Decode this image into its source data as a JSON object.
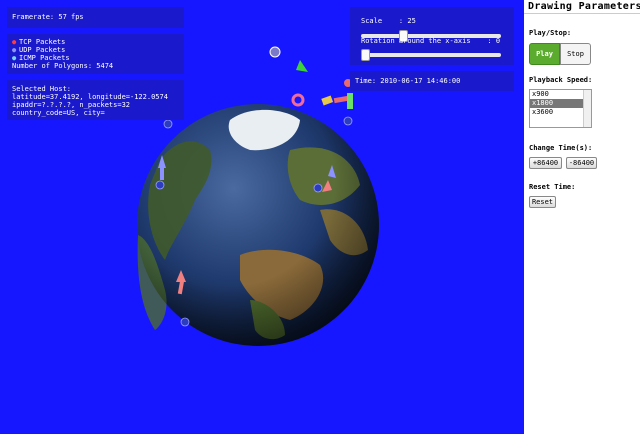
{
  "viewport": {
    "framerate": "Framerate: 57 fps",
    "legend": [
      "TCP Packets",
      "UDP Packets",
      "ICMP Packets"
    ],
    "polygons": "Number of Polygons: 5474",
    "host": [
      "Selected Host:",
      "latitude=37.4192, longitude=-122.0574",
      "ipaddr=?.?.?.?, n_packets=32",
      "country_code=US, city="
    ],
    "time": "Time: 2010-06-17 14:46:00",
    "scale_label": "Scale    : 25",
    "rotation_label": "Rotation around the x-axis    : 0",
    "scale_value": 25,
    "rotation_value": 0
  },
  "sidebar": {
    "title": "Drawing Parameters",
    "play_stop_label": "Play/Stop:",
    "play": "Play",
    "stop": "Stop",
    "speed_label": "Playback Speed:",
    "speeds": [
      "x900",
      "x1800",
      "x3600"
    ],
    "selected_speed": "x1800",
    "change_time_label": "Change Time(s):",
    "plus": "+86400",
    "minus": "-86400",
    "reset_label": "Reset Time:",
    "reset": "Reset"
  },
  "colors": {
    "viewport_bg": "#1717ff",
    "panel_bg": "#1a1acc",
    "play_green": "#5aab2e"
  }
}
